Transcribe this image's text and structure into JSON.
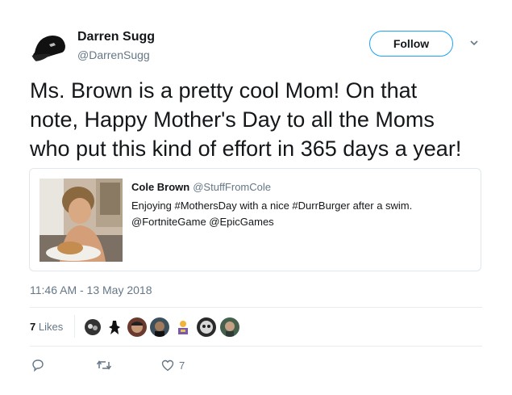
{
  "author": {
    "name": "Darren Sugg",
    "handle": "@DarrenSugg"
  },
  "follow_label": "Follow",
  "tweet": {
    "text": "Ms. Brown is a pretty cool Mom!  On that\nnote, Happy Mother's Day to all the Moms\nwho put this kind of effort in 365 days a year!"
  },
  "quoted": {
    "name": "Cole Brown",
    "handle": "@StuffFromCole",
    "text": "Enjoying #MothersDay with a nice #DurrBurger after a swim.\n@FortniteGame @EpicGames"
  },
  "timestamp": "11:46 AM - 13 May 2018",
  "likes": {
    "count": "7",
    "label": "Likes"
  },
  "actions": {
    "like_count": "7"
  },
  "colors": {
    "accent": "#1da1f2",
    "text": "#14171a",
    "muted": "#657786",
    "divider": "#e6ecf0"
  },
  "icons": [
    "black-cap-avatar",
    "chevron-down-icon",
    "reply-icon",
    "retweet-icon",
    "heart-icon"
  ]
}
